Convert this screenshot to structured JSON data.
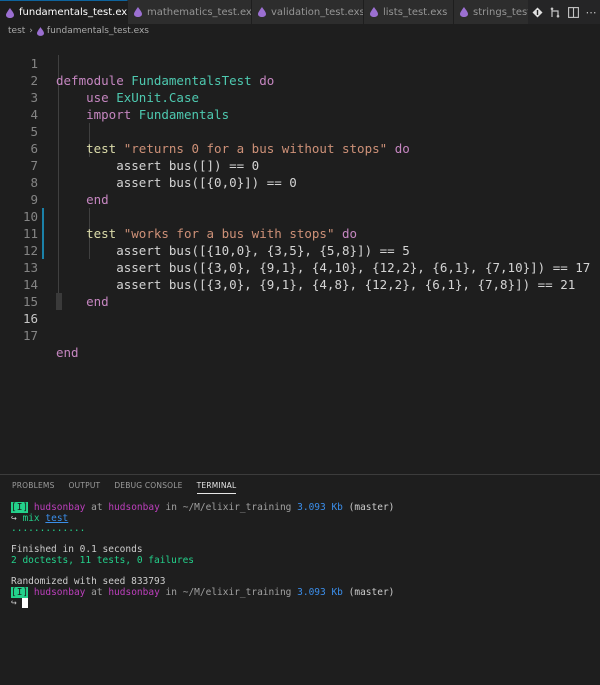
{
  "tabs": [
    {
      "label": "fundamentals_test.exs",
      "active": true
    },
    {
      "label": "mathematics_test.exs",
      "active": false
    },
    {
      "label": "validation_test.exs",
      "active": false
    },
    {
      "label": "lists_test.exs",
      "active": false
    },
    {
      "label": "strings_test.exs",
      "active": false
    }
  ],
  "breadcrumb": {
    "folder": "test",
    "file": "fundamentals_test.exs"
  },
  "line_numbers": [
    "1",
    "2",
    "3",
    "4",
    "5",
    "6",
    "7",
    "8",
    "9",
    "10",
    "11",
    "12",
    "13",
    "14",
    "15",
    "16",
    "17"
  ],
  "code_text": {
    "l1_kw": "defmodule",
    "l1_mod": "FundamentalsTest",
    "l1_do": "do",
    "l2_kw": "use",
    "l2_mod": "ExUnit.Case",
    "l3_kw": "import",
    "l3_mod": "Fundamentals",
    "l5_fn": "test",
    "l5_str": "\"returns 0 for a bus without stops\"",
    "l5_do": "do",
    "l6": "assert bus([]) == 0",
    "l7": "assert bus([{0,0}]) == 0",
    "l8": "end",
    "l10_fn": "test",
    "l10_str": "\"works for a bus with stops\"",
    "l10_do": "do",
    "l11": "assert bus([{10,0}, {3,5}, {5,8}]) == 5",
    "l12": "assert bus([{3,0}, {9,1}, {4,10}, {12,2}, {6,1}, {7,10}]) == 17",
    "l13": "assert bus([{3,0}, {9,1}, {4,8}, {12,2}, {6,1}, {7,8}]) == 21",
    "l14": "end",
    "l17": "end"
  },
  "panel_tabs": [
    "PROBLEMS",
    "OUTPUT",
    "DEBUG CONSOLE",
    "TERMINAL"
  ],
  "terminal": {
    "badge": "[I]",
    "user": "hudsonbay",
    "at": "at",
    "host": "hudsonbay",
    "in": "in",
    "path": "~/M/elixir_training",
    "size": "3.093 Kb",
    "branch": "(master)",
    "prompt": "↪",
    "cmd": "mix",
    "arg": "test",
    "dots": ".............",
    "finished": "Finished in 0.1 seconds",
    "summary": "2 doctests, 11 tests, 0 failures",
    "seed": "Randomized with seed 833793"
  },
  "colors": {
    "accent": "#0e639c",
    "success": "#23d18b",
    "user": "#bc3fbc",
    "path": "#3b8eea"
  }
}
